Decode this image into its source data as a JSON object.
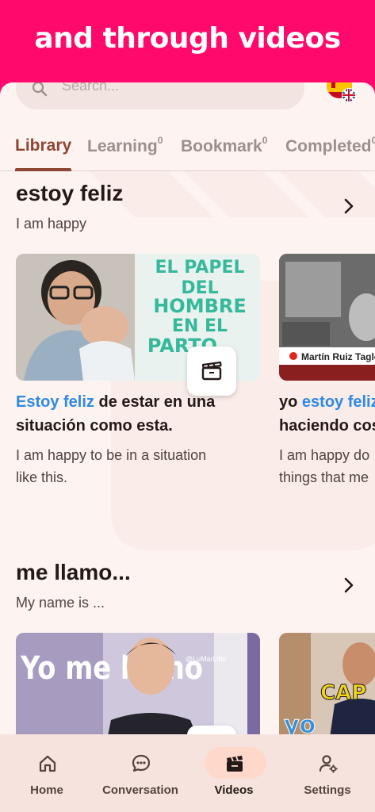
{
  "banner": {
    "text": "and through videos"
  },
  "search": {
    "placeholder": "Search..."
  },
  "tabs": [
    {
      "label": "Library",
      "count": ""
    },
    {
      "label": "Learning",
      "count": "0"
    },
    {
      "label": "Bookmark",
      "count": "0"
    },
    {
      "label": "Completed",
      "count": "0"
    }
  ],
  "sections": [
    {
      "title": "estoy feliz",
      "subtitle": "I am happy",
      "cards": [
        {
          "thumb_text": [
            "EL PAPEL",
            "DEL",
            "HOMBRE",
            "EN EL",
            "PARTO"
          ],
          "highlight": "Estoy feliz",
          "sentence_rest": " de estar en una",
          "sentence_line2": "situación como esta.",
          "translation_line1": "I am happy to be in a situation",
          "translation_line2": "like this."
        },
        {
          "thumb_caption": "Martín Ruiz Tagle",
          "sentence_pre": "yo ",
          "highlight": "estoy feliz",
          "sentence_line2": "haciendo cos",
          "translation_line1": "I am happy do",
          "translation_line2": "things that me"
        }
      ]
    },
    {
      "title": "me llamo...",
      "subtitle": "My name is ...",
      "cards": [
        {
          "thumb_text": "Yo me llamo",
          "watermark": "@LuMarLitte"
        },
        {
          "thumb_text": "CAP",
          "thumb_logo": "yo"
        }
      ]
    }
  ],
  "nav": [
    {
      "label": "Home",
      "icon": "home-icon"
    },
    {
      "label": "Conversation",
      "icon": "chat-icon"
    },
    {
      "label": "Videos",
      "icon": "video-icon"
    },
    {
      "label": "Settings",
      "icon": "user-settings-icon"
    }
  ],
  "colors": {
    "banner": "#ff0a6c",
    "accent": "#8d4634",
    "highlight": "#2f8ae0",
    "background": "#fdf3f1",
    "nav_background": "#f7e3dd",
    "nav_active_pill": "#ffd8cc"
  }
}
